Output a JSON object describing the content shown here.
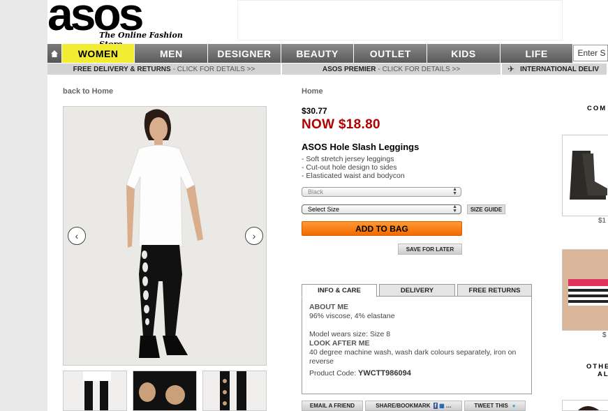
{
  "header": {
    "brand": "asos",
    "tagline": "The Online Fashion Store"
  },
  "nav": {
    "tabs": [
      {
        "label": "WOMEN"
      },
      {
        "label": "MEN"
      },
      {
        "label": "DESIGNER"
      },
      {
        "label": "BEAUTY"
      },
      {
        "label": "OUTLET"
      },
      {
        "label": "KIDS"
      },
      {
        "label": "LIFE"
      }
    ],
    "search_value": "Enter S"
  },
  "promo": {
    "delivery_bold": "FREE DELIVERY & RETURNS",
    "delivery_sub": "- CLICK FOR DETAILS >>",
    "premier_bold": "ASOS PREMIER",
    "premier_sub": "- CLICK FOR DETAILS >>",
    "international_bold": "INTERNATIONAL DELIV"
  },
  "back_link": "back to Home",
  "breadcrumb": "Home",
  "product": {
    "price_old": "$30.77",
    "price_now": "NOW $18.80",
    "name": "ASOS Hole Slash Leggings",
    "features": [
      "- Soft stretch jersey leggings",
      "- Cut-out hole design to sides",
      "- Elasticated waist and bodycon"
    ],
    "colour_select": "Black",
    "size_select": "Select Size",
    "size_guide": "SIZE GUIDE",
    "add_to_bag": "ADD TO BAG",
    "save_for_later": "SAVE FOR LATER"
  },
  "info_tabs": [
    {
      "label": "INFO & CARE"
    },
    {
      "label": "DELIVERY"
    },
    {
      "label": "FREE RETURNS"
    }
  ],
  "info": {
    "about_heading": "ABOUT ME",
    "about_text": "96% viscose, 4% elastane",
    "model_size": "Model wears size: Size 8",
    "care_heading": "LOOK AFTER ME",
    "care_text": "40 degree machine wash, wash dark colours separately, iron on reverse",
    "code_label": "Product Code:",
    "code_value": "YWCTT986094"
  },
  "share": {
    "email": "EMAIL A FRIEND",
    "bookmark": "SHARE/BOOKMARK",
    "tweet": "TWEET THIS"
  },
  "sidebar": {
    "heading1": "COM",
    "price1": "$1",
    "price2": "$",
    "heading2_line1": "OTHE",
    "heading2_line2": "AL"
  },
  "colors": {
    "active_tab": "#f2ec32",
    "sale_price": "#b00000",
    "add_to_bag": "#f26a00"
  }
}
